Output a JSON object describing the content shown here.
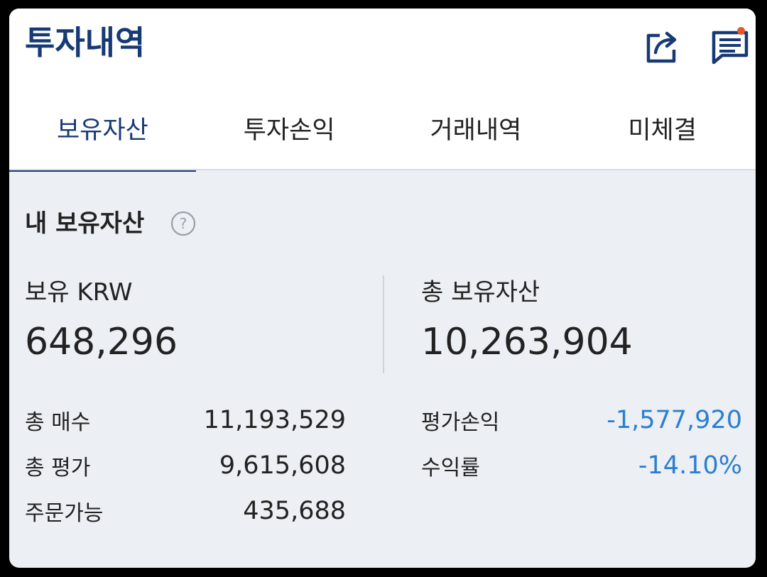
{
  "header": {
    "title": "투자내역",
    "share_icon": "share-icon",
    "chat_icon": "chat-list-icon",
    "notification_color": "#e25a2c"
  },
  "tabs": [
    {
      "label": "보유자산",
      "active": true
    },
    {
      "label": "투자손익",
      "active": false
    },
    {
      "label": "거래내역",
      "active": false
    },
    {
      "label": "미체결",
      "active": false
    }
  ],
  "section": {
    "title": "내 보유자산",
    "help_icon": "question-icon"
  },
  "summary": {
    "krw_label": "보유 KRW",
    "krw_value": "648,296",
    "total_label": "총 보유자산",
    "total_value": "10,263,904"
  },
  "details_left": [
    {
      "label": "총 매수",
      "value": "11,193,529"
    },
    {
      "label": "총 평가",
      "value": "9,615,608"
    },
    {
      "label": "주문가능",
      "value": "435,688"
    }
  ],
  "details_right": [
    {
      "label": "평가손익",
      "value": "-1,577,920"
    },
    {
      "label": "수익률",
      "value": "-14.10%"
    }
  ],
  "colors": {
    "brand": "#173a75",
    "negative": "#2a7fd1",
    "background": "#eceff4"
  }
}
